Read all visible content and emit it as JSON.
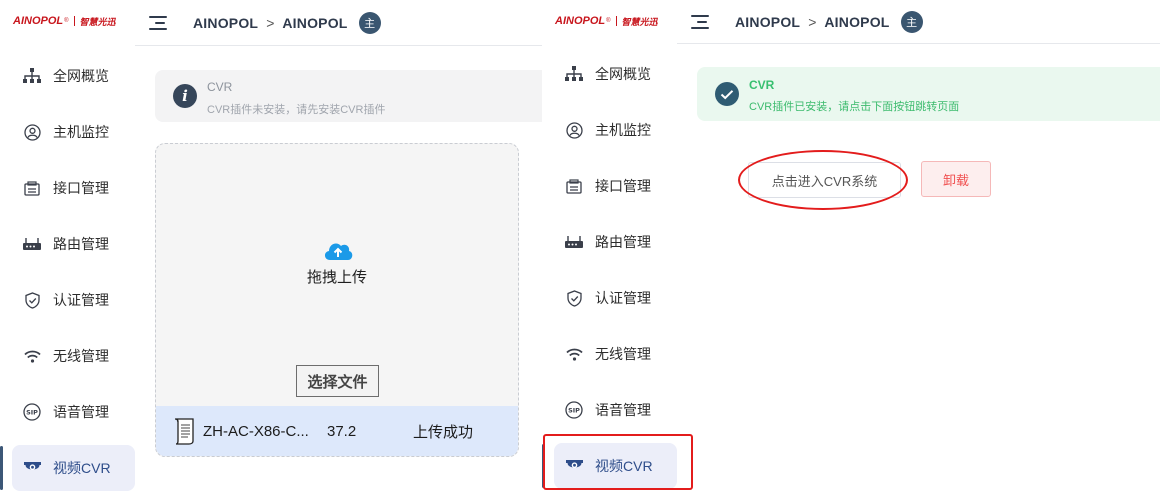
{
  "logo": {
    "brand": "AINOPOL",
    "reg": "®",
    "tagline": "智慧光迅"
  },
  "breadcrumb": {
    "first": "AINOPOL",
    "separator": ">",
    "second": "AINOPOL",
    "avatar_text": "主"
  },
  "sidebar": {
    "items": [
      {
        "label": "全网概览",
        "icon": "network-topology-icon"
      },
      {
        "label": "主机监控",
        "icon": "user-circle-icon"
      },
      {
        "label": "接口管理",
        "icon": "interface-icon"
      },
      {
        "label": "路由管理",
        "icon": "router-icon"
      },
      {
        "label": "认证管理",
        "icon": "shield-check-icon"
      },
      {
        "label": "无线管理",
        "icon": "wifi-icon"
      },
      {
        "label": "语音管理",
        "icon": "sip-icon"
      },
      {
        "label": "视频CVR",
        "icon": "camera-icon",
        "active": true
      }
    ]
  },
  "left": {
    "alert": {
      "title": "CVR",
      "description": "CVR插件未安装，请先安装CVR插件"
    },
    "upload": {
      "drag_text": "拖拽上传",
      "select_label": "选择文件",
      "file": {
        "name": "ZH-AC-X86-C...",
        "size": "37.2",
        "status": "上传成功"
      }
    }
  },
  "right": {
    "alert": {
      "title": "CVR",
      "description": "CVR插件已安装，请点击下面按钮跳转页面"
    },
    "enter_label": "点击进入CVR系统",
    "uninstall_label": "卸载"
  },
  "colors": {
    "accent": "#3c5777",
    "brand_red": "#c8161d",
    "success_green": "#38c070",
    "danger_red": "#f05050",
    "annotation_red": "#e31c1c"
  }
}
